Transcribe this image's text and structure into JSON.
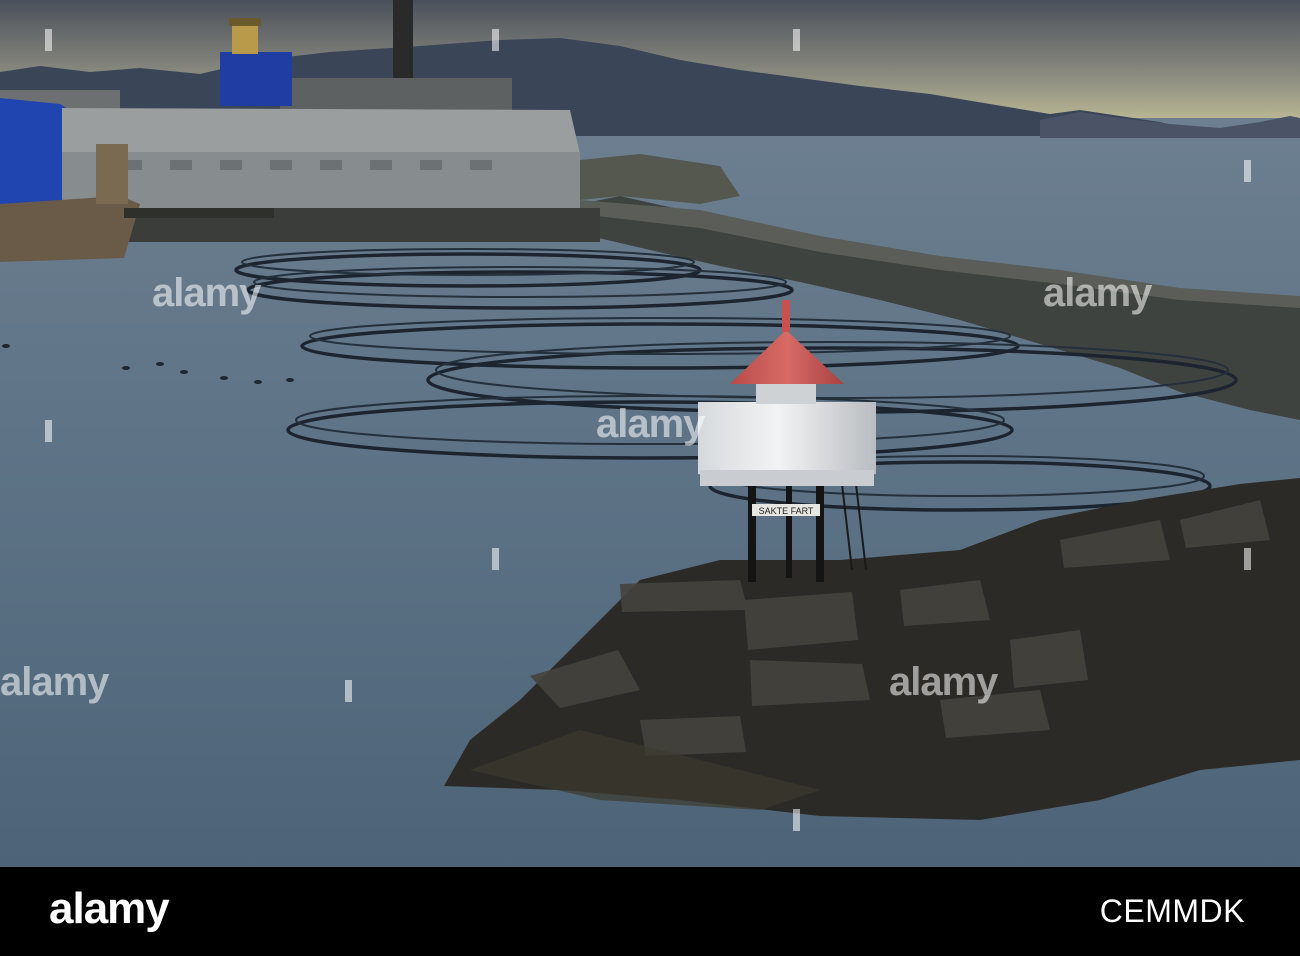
{
  "footer": {
    "logo": "alamy",
    "image_id": "CEMMDK"
  },
  "watermark": {
    "text": "alamy"
  },
  "sign": {
    "text": "SAKTE FART"
  },
  "colors": {
    "sky_top": "#4e5460",
    "sky_horizon": "#c9c79c",
    "water": "#5a6f82",
    "mountains": "#3b4759",
    "lighthouse_roof": "#c8504e",
    "lighthouse_body": "#e6e8ea",
    "warehouse": "#8c9194",
    "blue_building": "#1d3ba0",
    "rocks": "#2e2c28"
  }
}
